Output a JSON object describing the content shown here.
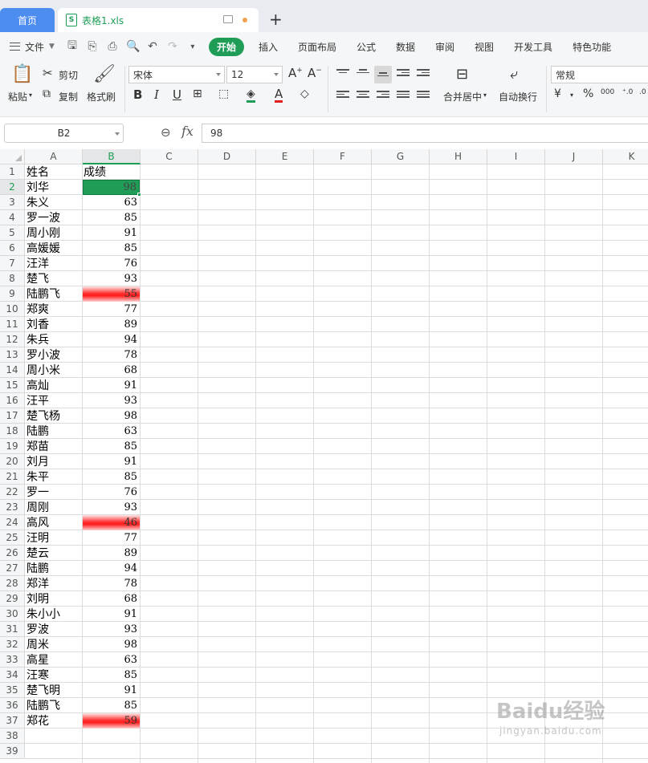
{
  "tabs": {
    "home": "首页",
    "file": "表格1.xls",
    "file_icon": "S"
  },
  "menu": {
    "file": "文件",
    "items": [
      "开始",
      "插入",
      "页面布局",
      "公式",
      "数据",
      "审阅",
      "视图",
      "开发工具",
      "特色功能"
    ]
  },
  "ribbon": {
    "paste": "粘贴",
    "cut": "剪切",
    "copy": "复制",
    "format_painter": "格式刷",
    "font_name": "宋体",
    "font_size": "12",
    "merge_center": "合并居中",
    "wrap_text": "自动换行",
    "number_format": "常规"
  },
  "formula": {
    "cell_ref": "B2",
    "fx": "fx",
    "value": "98"
  },
  "columns": [
    "A",
    "B",
    "C",
    "D",
    "E",
    "F",
    "G",
    "H",
    "I",
    "J",
    "K"
  ],
  "header_row": {
    "name": "姓名",
    "score": "成绩"
  },
  "rows": [
    {
      "name": "刘华",
      "score": "98"
    },
    {
      "name": "朱义",
      "score": "63"
    },
    {
      "name": "罗一波",
      "score": "85"
    },
    {
      "name": "周小刚",
      "score": "91"
    },
    {
      "name": "高媛媛",
      "score": "85"
    },
    {
      "name": "汪洋",
      "score": "76"
    },
    {
      "name": "楚飞",
      "score": "93"
    },
    {
      "name": "陆鹏飞",
      "score": "55"
    },
    {
      "name": "郑爽",
      "score": "77"
    },
    {
      "name": "刘香",
      "score": "89"
    },
    {
      "name": "朱兵",
      "score": "94"
    },
    {
      "name": "罗小波",
      "score": "78"
    },
    {
      "name": "周小米",
      "score": "68"
    },
    {
      "name": "高灿",
      "score": "91"
    },
    {
      "name": "汪平",
      "score": "93"
    },
    {
      "name": "楚飞杨",
      "score": "98"
    },
    {
      "name": "陆鹏",
      "score": "63"
    },
    {
      "name": "郑苗",
      "score": "85"
    },
    {
      "name": "刘月",
      "score": "91"
    },
    {
      "name": "朱平",
      "score": "85"
    },
    {
      "name": "罗一",
      "score": "76"
    },
    {
      "name": "周刚",
      "score": "93"
    },
    {
      "name": "高风",
      "score": "46"
    },
    {
      "name": "汪明",
      "score": "77"
    },
    {
      "name": "楚云",
      "score": "89"
    },
    {
      "name": "陆鹏",
      "score": "94"
    },
    {
      "name": "郑洋",
      "score": "78"
    },
    {
      "name": "刘明",
      "score": "68"
    },
    {
      "name": "朱小小",
      "score": "91"
    },
    {
      "name": "罗波",
      "score": "93"
    },
    {
      "name": "周米",
      "score": "98"
    },
    {
      "name": "高星",
      "score": "63"
    },
    {
      "name": "汪寒",
      "score": "85"
    },
    {
      "name": "楚飞明",
      "score": "91"
    },
    {
      "name": "陆鹏飞",
      "score": "85"
    },
    {
      "name": "郑花",
      "score": "59"
    }
  ],
  "row_count": 39,
  "selected_cell": "B2",
  "highlight_threshold": 60,
  "colors": {
    "accent": "#1f9d57",
    "tab_blue": "#4e8df0",
    "low_red": "#ff1a1a"
  },
  "watermark": {
    "line1": "Baidu经验",
    "line2": "jingyan.baidu.com"
  }
}
